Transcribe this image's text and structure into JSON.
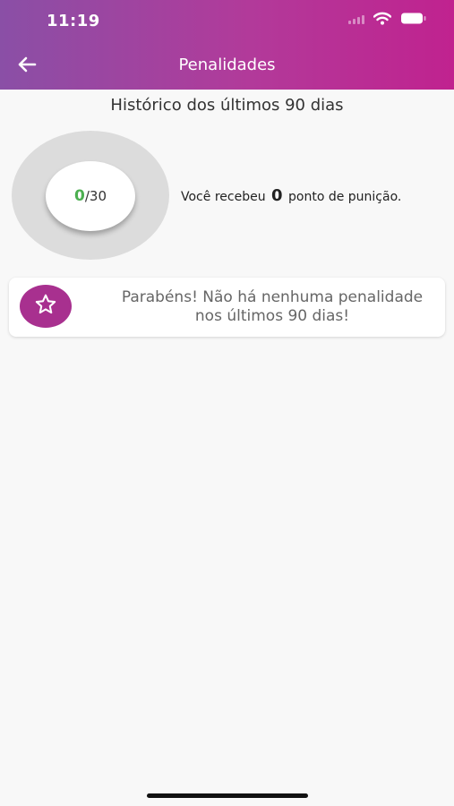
{
  "status_bar": {
    "time": "11:19"
  },
  "header": {
    "title": "Penalidades"
  },
  "history": {
    "heading": "Histórico dos últimos 90 dias"
  },
  "gauge": {
    "value": "0",
    "max_label": "/30"
  },
  "penalty": {
    "prefix": "Você recebeu",
    "points": "0",
    "suffix": "ponto de punição."
  },
  "congrats": {
    "message": "Parabéns! Não há nenhuma penalidade nos últimos 90 dias!"
  },
  "colors": {
    "header_start": "#8a4fa6",
    "header_end": "#c0228f",
    "accent": "#a8308f",
    "gauge_value": "#4caf50"
  },
  "icons": {
    "back": "arrow-left-icon",
    "badge": "star-icon"
  }
}
